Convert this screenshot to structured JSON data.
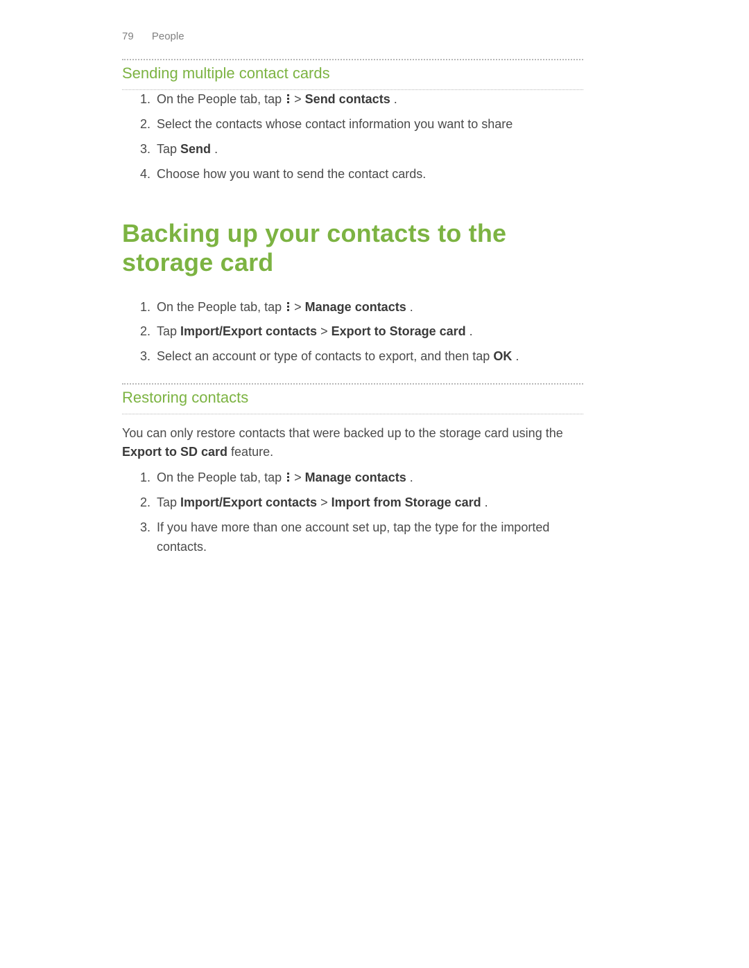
{
  "header": {
    "page_number": "79",
    "section": "People"
  },
  "section1": {
    "title": "Sending multiple contact cards",
    "steps": {
      "s1a": "On the People tab, tap ",
      "s1b": " > ",
      "s1c": "Send contacts",
      "s1d": ".",
      "s2": "Select the contacts whose contact information you want to share",
      "s3a": "Tap ",
      "s3b": "Send",
      "s3c": ".",
      "s4": "Choose how you want to send the contact cards."
    }
  },
  "section2": {
    "title": "Backing up your contacts to the storage card",
    "steps": {
      "s1a": "On the People tab, tap ",
      "s1b": " > ",
      "s1c": "Manage contacts",
      "s1d": ".",
      "s2a": "Tap ",
      "s2b": "Import/Export contacts",
      "s2c": " > ",
      "s2d": "Export to Storage card",
      "s2e": ".",
      "s3a": "Select an account or type of contacts to export, and then tap ",
      "s3b": "OK",
      "s3c": "."
    }
  },
  "section3": {
    "title": "Restoring contacts",
    "intro_a": "You can only restore contacts that were backed up to the storage card using the ",
    "intro_b": "Export to SD card",
    "intro_c": " feature.",
    "steps": {
      "s1a": "On the People tab, tap ",
      "s1b": " > ",
      "s1c": "Manage contacts",
      "s1d": ".",
      "s2a": "Tap ",
      "s2b": "Import/Export contacts",
      "s2c": " > ",
      "s2d": "Import from Storage card",
      "s2e": ".",
      "s3": "If you have more than one account set up, tap the type for the imported contacts."
    }
  }
}
